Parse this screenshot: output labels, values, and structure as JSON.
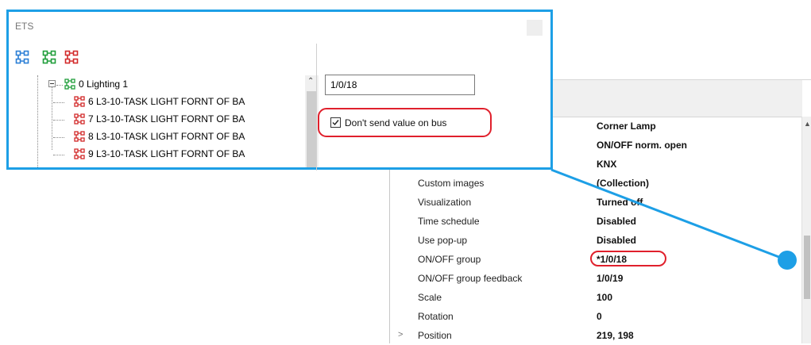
{
  "ets_window": {
    "title": "ETS",
    "toolbar": [
      {
        "icon": "group-address-icon-blue",
        "color": "#2b7fd6"
      },
      {
        "icon": "group-address-icon-green",
        "color": "#1f9d3a"
      },
      {
        "icon": "group-address-icon-red",
        "color": "#d22a2a"
      }
    ],
    "tree": {
      "parent": {
        "label": "0 Lighting 1",
        "icon_color": "#1f9d3a",
        "expanded": true
      },
      "children": [
        {
          "label": "6 L3-10-TASK LIGHT FORNT OF BA",
          "icon_color": "#d22a2a"
        },
        {
          "label": "7 L3-10-TASK LIGHT FORNT OF BA",
          "icon_color": "#d22a2a"
        },
        {
          "label": "8 L3-10-TASK LIGHT FORNT OF BA",
          "icon_color": "#d22a2a"
        },
        {
          "label": "9 L3-10-TASK LIGHT FORNT OF BA",
          "icon_color": "#d22a2a"
        }
      ]
    },
    "address_value": "1/0/18",
    "dont_send": {
      "label": "Don't send value on bus",
      "checked": true
    }
  },
  "properties": {
    "rows": [
      {
        "name": "",
        "value": "Corner Lamp"
      },
      {
        "name": "",
        "value": "ON/OFF norm. open"
      },
      {
        "name": "",
        "value": "KNX"
      },
      {
        "name": "Custom images",
        "value": "(Collection)"
      },
      {
        "name": "Visualization",
        "value": "Turned off"
      },
      {
        "name": "Time schedule",
        "value": "Disabled"
      },
      {
        "name": "Use pop-up",
        "value": "Disabled"
      },
      {
        "name": "ON/OFF group",
        "value": "*1/0/18",
        "highlighted": true
      },
      {
        "name": "ON/OFF group feedback",
        "value": "1/0/19"
      },
      {
        "name": "Scale",
        "value": "100"
      },
      {
        "name": "Rotation",
        "value": "0"
      },
      {
        "name": "Position",
        "value": "219, 198",
        "expandable": true,
        "expander": ">"
      }
    ]
  },
  "colors": {
    "accent_blue": "#1d9fe6",
    "highlight_red": "#e0202c"
  }
}
